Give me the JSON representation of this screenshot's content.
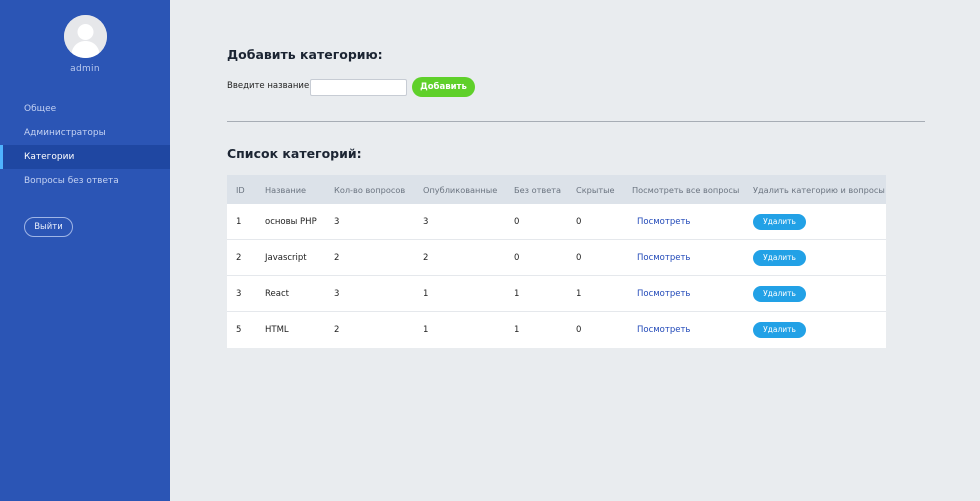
{
  "sidebar": {
    "username": "admin",
    "items": [
      {
        "label": "Общее",
        "active": false
      },
      {
        "label": "Администраторы",
        "active": false
      },
      {
        "label": "Категории",
        "active": true
      },
      {
        "label": "Вопросы без ответа",
        "active": false
      }
    ],
    "logout_label": "Выйти"
  },
  "add_form": {
    "heading": "Добавить категорию:",
    "label": "Введите название:",
    "input_value": "",
    "button_label": "Добавить"
  },
  "list": {
    "heading": "Список категорий:",
    "columns": [
      "ID",
      "Название",
      "Кол-во вопросов",
      "Опубликованные",
      "Без ответа",
      "Скрытые",
      "Посмотреть все вопросы",
      "Удалить категорию и вопросы"
    ],
    "rows": [
      {
        "id": "1",
        "name": "основы PHP",
        "count": "3",
        "published": "3",
        "unanswered": "0",
        "hidden": "0",
        "view": "Посмотреть",
        "delete": "Удалить"
      },
      {
        "id": "2",
        "name": "Javascript",
        "count": "2",
        "published": "2",
        "unanswered": "0",
        "hidden": "0",
        "view": "Посмотреть",
        "delete": "Удалить"
      },
      {
        "id": "3",
        "name": "React",
        "count": "3",
        "published": "1",
        "unanswered": "1",
        "hidden": "1",
        "view": "Посмотреть",
        "delete": "Удалить"
      },
      {
        "id": "5",
        "name": "HTML",
        "count": "2",
        "published": "1",
        "unanswered": "1",
        "hidden": "0",
        "view": "Посмотреть",
        "delete": "Удалить"
      }
    ]
  },
  "colors": {
    "sidebar_bg": "#2b55b5",
    "sidebar_active": "#1f47a2",
    "add_button": "#5fd02a",
    "delete_button": "#22a1e6",
    "link": "#2048b8",
    "page_bg": "#e9ecef"
  },
  "icons": {
    "avatar": "user-avatar-icon"
  }
}
